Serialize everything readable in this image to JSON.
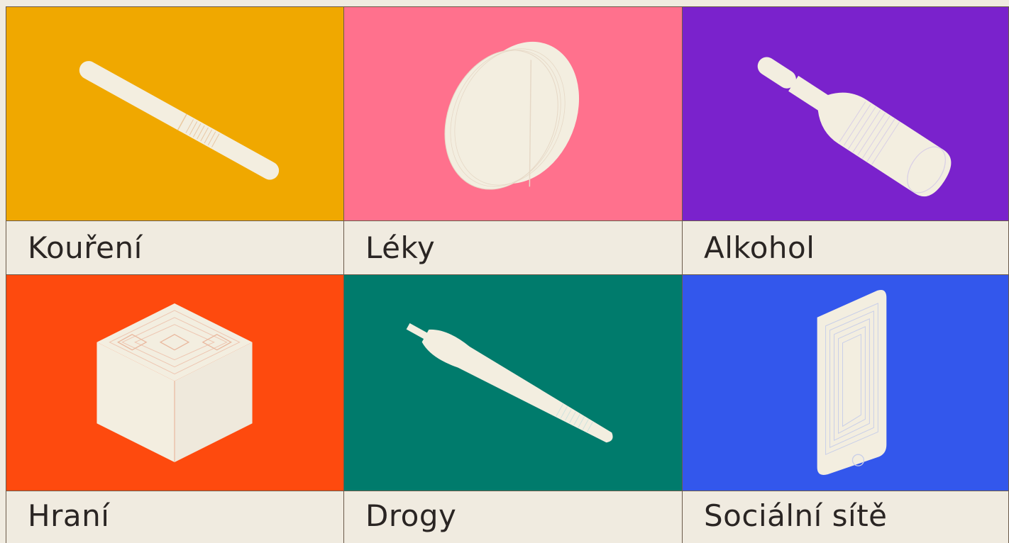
{
  "categories": [
    {
      "label": "Kouření",
      "color": "#f0a800",
      "icon": "cigarette-icon"
    },
    {
      "label": "Léky",
      "color": "#ff718d",
      "icon": "pill-icon"
    },
    {
      "label": "Alkohol",
      "color": "#7a22cc",
      "icon": "bottle-icon"
    },
    {
      "label": "Hraní",
      "color": "#fe4a0e",
      "icon": "cube-icon"
    },
    {
      "label": "Drogy",
      "color": "#007b6c",
      "icon": "joint-icon"
    },
    {
      "label": "Sociální sítě",
      "color": "#3357ec",
      "icon": "smartphone-icon"
    }
  ],
  "icon_color": "#f3eee0"
}
